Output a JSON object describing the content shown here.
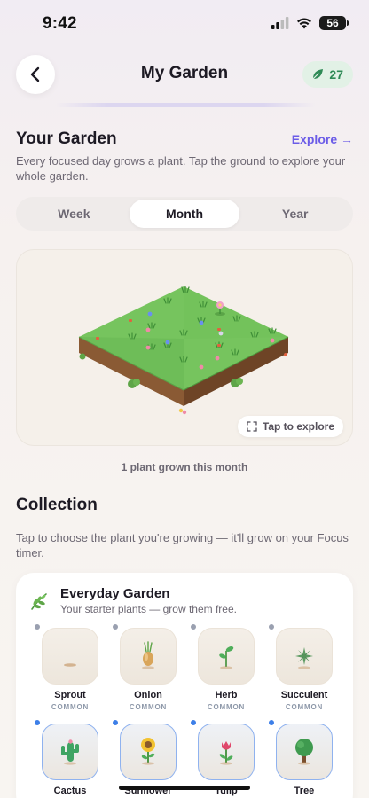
{
  "status_bar": {
    "time": "9:42",
    "battery": "56"
  },
  "header": {
    "title": "My Garden",
    "leaf_count": "27"
  },
  "your_garden": {
    "title": "Your Garden",
    "explore_label": "Explore →",
    "description": "Every focused day grows a plant. Tap the ground to explore your whole garden."
  },
  "tabs": [
    {
      "label": "Week",
      "active": false
    },
    {
      "label": "Month",
      "active": true
    },
    {
      "label": "Year",
      "active": false
    }
  ],
  "garden_preview": {
    "tap_label": "Tap to explore",
    "summary": "1 plant grown this month"
  },
  "collection": {
    "title": "Collection",
    "description": "Tap to choose the plant you're growing — it'll grow on your Focus timer.",
    "group": {
      "name": "Everyday Garden",
      "description": "Your starter plants — grow them free.",
      "plants": [
        {
          "name": "Sprout",
          "rarity": "COMMON",
          "icon": "sprout-icon"
        },
        {
          "name": "Onion",
          "rarity": "COMMON",
          "icon": "onion-icon"
        },
        {
          "name": "Herb",
          "rarity": "COMMON",
          "icon": "herb-icon"
        },
        {
          "name": "Succulent",
          "rarity": "COMMON",
          "icon": "succulent-icon"
        },
        {
          "name": "Cactus",
          "rarity": "",
          "icon": "cactus-icon"
        },
        {
          "name": "Sunflower",
          "rarity": "",
          "icon": "sunflower-icon"
        },
        {
          "name": "Tulip",
          "rarity": "",
          "icon": "tulip-icon"
        },
        {
          "name": "Tree",
          "rarity": "",
          "icon": "tree-icon"
        }
      ]
    }
  },
  "colors": {
    "accent": "#6b5ce7",
    "leaf_green": "#2f8a56",
    "selected_dot": "#3d7fe8"
  }
}
